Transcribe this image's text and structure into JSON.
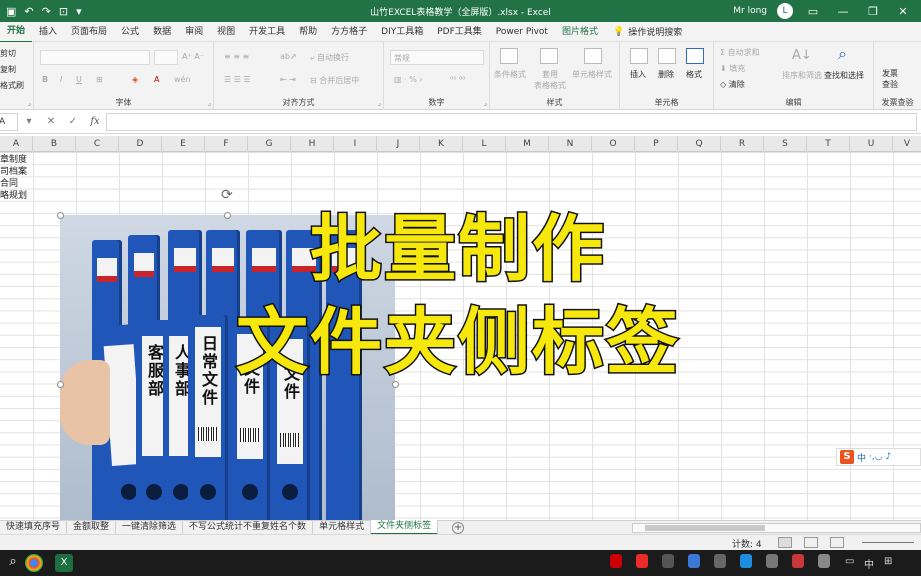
{
  "titlebar": {
    "title": "山竹EXCEL表格教学（全屏版）.xlsx  -  Excel",
    "user": "Mr long",
    "avatar_initial": "L",
    "min": "—",
    "restore": "❐",
    "close": "✕"
  },
  "ribbon_tabs": [
    "开始",
    "插入",
    "页面布局",
    "公式",
    "数据",
    "审阅",
    "视图",
    "开发工具",
    "帮助",
    "方方格子",
    "DIY工具箱",
    "PDF工具集",
    "Power Pivot",
    "图片格式"
  ],
  "tell_me": "操作说明搜索",
  "ribbon": {
    "clipboard_items": [
      "剪切",
      "复制",
      "格式刷"
    ],
    "font_group": "字体",
    "align_group": "对齐方式",
    "wrap": "自动换行",
    "merge": "合并后居中",
    "number_group": "数字",
    "number_format": "常规",
    "styles_group": "样式",
    "cond_format": "条件格式",
    "table_format": "套用\n表格格式",
    "cell_style": "单元格样式",
    "cells_group": "单元格",
    "insert": "插入",
    "delete": "删除",
    "format": "格式",
    "edit_group": "编辑",
    "autosum": "自动求和",
    "fill": "填充",
    "clear": "清除",
    "sort": "排序和筛选",
    "find": "查找和选择",
    "send_group": "发票查验",
    "send_btn": "发票\n查验"
  },
  "formula_bar": {
    "name_box": "A",
    "cancel": "✕",
    "enter": "✓",
    "fx": "fx"
  },
  "columns": [
    "A",
    "B",
    "C",
    "D",
    "E",
    "F",
    "G",
    "H",
    "I",
    "J",
    "K",
    "L",
    "M",
    "N",
    "O",
    "P",
    "Q",
    "R",
    "S",
    "T",
    "U",
    "V"
  ],
  "cells_a": [
    "章制度",
    "司档案",
    "合同",
    "略规划"
  ],
  "overlay": {
    "line1": "批量制作",
    "line2": "文件夹侧标签"
  },
  "binder_labels": [
    "客服部",
    "人事部",
    "日常文件",
    "文件",
    "文件"
  ],
  "ime": {
    "logo": "S",
    "mode": "中",
    "icons": "·,◡ ♪"
  },
  "sheets": [
    "快速填充序号",
    "金额取整",
    "一键清除筛选",
    "不写公式统计不重复姓名个数",
    "单元格样式",
    "文件夹侧标签"
  ],
  "active_sheet": "文件夹侧标签",
  "status": {
    "count": "计数: 4"
  },
  "taskbar": {
    "tray_lang": "中",
    "tray_time": ""
  },
  "colors": {
    "accent": "#217346",
    "overlay_fill": "#f6e80c",
    "binder": "#1f56b8"
  }
}
